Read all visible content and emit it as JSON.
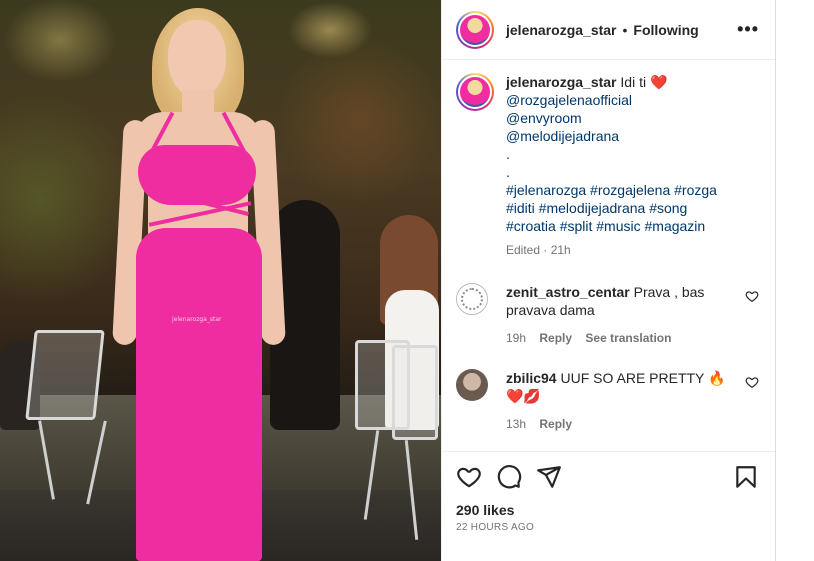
{
  "post": {
    "author": "jelenarozga_star",
    "separator": "•",
    "follow_status": "Following",
    "more_label": "•••",
    "photo_watermark": "jelenarozga_star"
  },
  "caption": {
    "author": "jelenarozga_star",
    "text": "Idi ti",
    "emoji": "❤️",
    "mentions": [
      "@rozgajelenaofficial",
      "@envyroom",
      "@melodijejadrana"
    ],
    "dots": [
      ".",
      "."
    ],
    "hashtags": [
      "#jelenarozga #rozgajelena #rozga",
      "#iditi #melodijejadrana #song",
      "#croatia #split #music #magazin"
    ],
    "meta": "Edited · 21h"
  },
  "comments": [
    {
      "author": "zenit_astro_centar",
      "text": "Prava , bas pravava dama",
      "time": "19h",
      "reply": "Reply",
      "translate": "See translation"
    },
    {
      "author": "zbilic94",
      "text": "UUF SO ARE PRETTY 🔥❤️💋",
      "time": "13h",
      "reply": "Reply"
    }
  ],
  "engagement": {
    "likes": "290 likes",
    "timestamp": "22 HOURS AGO"
  },
  "icons": [
    "like-icon",
    "comment-icon",
    "share-icon",
    "save-icon",
    "more-icon",
    "comment-like-icon"
  ],
  "colors": {
    "dress": "#f02da0",
    "link": "#00376b",
    "muted": "#737373",
    "heart": "#e0245e"
  }
}
